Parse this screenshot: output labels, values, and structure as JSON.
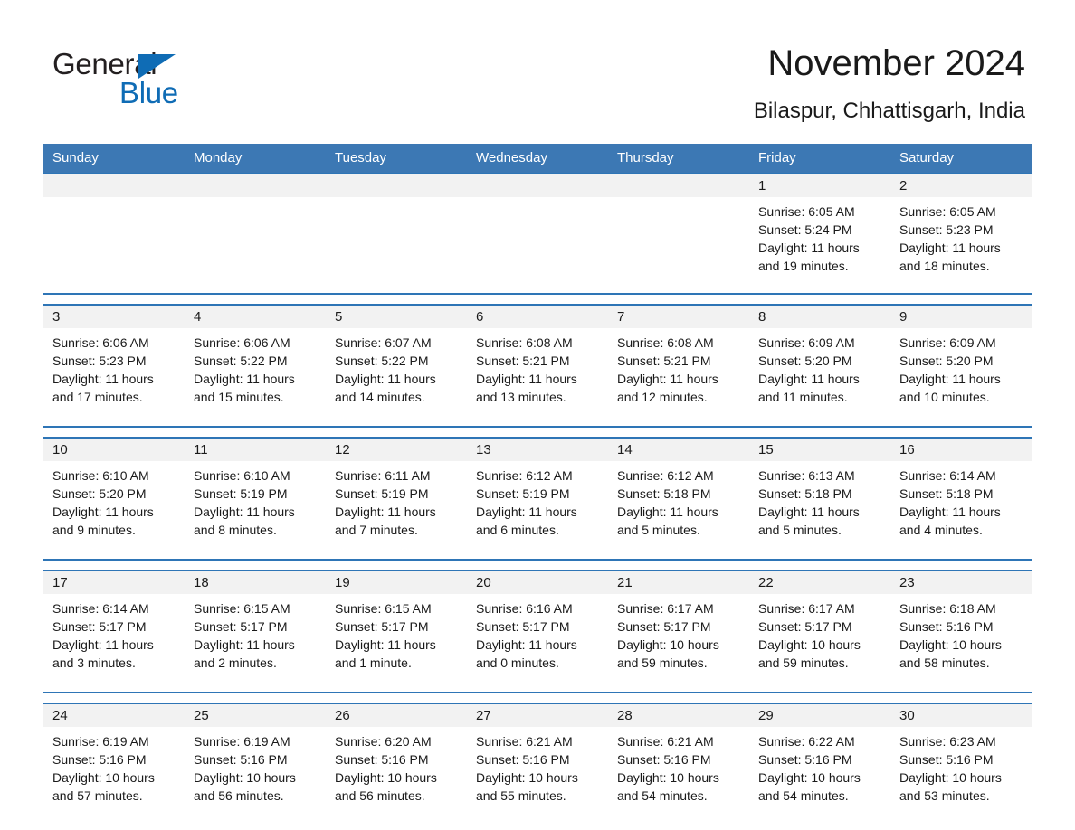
{
  "brand": {
    "name_part1": "General",
    "name_part2": "Blue",
    "triangle_color": "#0f6cb5"
  },
  "header": {
    "month_title": "November 2024",
    "location": "Bilaspur, Chhattisgarh, India"
  },
  "theme": {
    "header_blue": "#3c78b4",
    "row_border_blue": "#2e75b6",
    "daynum_band": "#f2f2f2",
    "text": "#1a1a1a"
  },
  "weekdays": [
    "Sunday",
    "Monday",
    "Tuesday",
    "Wednesday",
    "Thursday",
    "Friday",
    "Saturday"
  ],
  "weeks": [
    [
      {
        "day": "",
        "sunrise": "",
        "sunset": "",
        "daylight1": "",
        "daylight2": ""
      },
      {
        "day": "",
        "sunrise": "",
        "sunset": "",
        "daylight1": "",
        "daylight2": ""
      },
      {
        "day": "",
        "sunrise": "",
        "sunset": "",
        "daylight1": "",
        "daylight2": ""
      },
      {
        "day": "",
        "sunrise": "",
        "sunset": "",
        "daylight1": "",
        "daylight2": ""
      },
      {
        "day": "",
        "sunrise": "",
        "sunset": "",
        "daylight1": "",
        "daylight2": ""
      },
      {
        "day": "1",
        "sunrise": "Sunrise: 6:05 AM",
        "sunset": "Sunset: 5:24 PM",
        "daylight1": "Daylight: 11 hours",
        "daylight2": "and 19 minutes."
      },
      {
        "day": "2",
        "sunrise": "Sunrise: 6:05 AM",
        "sunset": "Sunset: 5:23 PM",
        "daylight1": "Daylight: 11 hours",
        "daylight2": "and 18 minutes."
      }
    ],
    [
      {
        "day": "3",
        "sunrise": "Sunrise: 6:06 AM",
        "sunset": "Sunset: 5:23 PM",
        "daylight1": "Daylight: 11 hours",
        "daylight2": "and 17 minutes."
      },
      {
        "day": "4",
        "sunrise": "Sunrise: 6:06 AM",
        "sunset": "Sunset: 5:22 PM",
        "daylight1": "Daylight: 11 hours",
        "daylight2": "and 15 minutes."
      },
      {
        "day": "5",
        "sunrise": "Sunrise: 6:07 AM",
        "sunset": "Sunset: 5:22 PM",
        "daylight1": "Daylight: 11 hours",
        "daylight2": "and 14 minutes."
      },
      {
        "day": "6",
        "sunrise": "Sunrise: 6:08 AM",
        "sunset": "Sunset: 5:21 PM",
        "daylight1": "Daylight: 11 hours",
        "daylight2": "and 13 minutes."
      },
      {
        "day": "7",
        "sunrise": "Sunrise: 6:08 AM",
        "sunset": "Sunset: 5:21 PM",
        "daylight1": "Daylight: 11 hours",
        "daylight2": "and 12 minutes."
      },
      {
        "day": "8",
        "sunrise": "Sunrise: 6:09 AM",
        "sunset": "Sunset: 5:20 PM",
        "daylight1": "Daylight: 11 hours",
        "daylight2": "and 11 minutes."
      },
      {
        "day": "9",
        "sunrise": "Sunrise: 6:09 AM",
        "sunset": "Sunset: 5:20 PM",
        "daylight1": "Daylight: 11 hours",
        "daylight2": "and 10 minutes."
      }
    ],
    [
      {
        "day": "10",
        "sunrise": "Sunrise: 6:10 AM",
        "sunset": "Sunset: 5:20 PM",
        "daylight1": "Daylight: 11 hours",
        "daylight2": "and 9 minutes."
      },
      {
        "day": "11",
        "sunrise": "Sunrise: 6:10 AM",
        "sunset": "Sunset: 5:19 PM",
        "daylight1": "Daylight: 11 hours",
        "daylight2": "and 8 minutes."
      },
      {
        "day": "12",
        "sunrise": "Sunrise: 6:11 AM",
        "sunset": "Sunset: 5:19 PM",
        "daylight1": "Daylight: 11 hours",
        "daylight2": "and 7 minutes."
      },
      {
        "day": "13",
        "sunrise": "Sunrise: 6:12 AM",
        "sunset": "Sunset: 5:19 PM",
        "daylight1": "Daylight: 11 hours",
        "daylight2": "and 6 minutes."
      },
      {
        "day": "14",
        "sunrise": "Sunrise: 6:12 AM",
        "sunset": "Sunset: 5:18 PM",
        "daylight1": "Daylight: 11 hours",
        "daylight2": "and 5 minutes."
      },
      {
        "day": "15",
        "sunrise": "Sunrise: 6:13 AM",
        "sunset": "Sunset: 5:18 PM",
        "daylight1": "Daylight: 11 hours",
        "daylight2": "and 5 minutes."
      },
      {
        "day": "16",
        "sunrise": "Sunrise: 6:14 AM",
        "sunset": "Sunset: 5:18 PM",
        "daylight1": "Daylight: 11 hours",
        "daylight2": "and 4 minutes."
      }
    ],
    [
      {
        "day": "17",
        "sunrise": "Sunrise: 6:14 AM",
        "sunset": "Sunset: 5:17 PM",
        "daylight1": "Daylight: 11 hours",
        "daylight2": "and 3 minutes."
      },
      {
        "day": "18",
        "sunrise": "Sunrise: 6:15 AM",
        "sunset": "Sunset: 5:17 PM",
        "daylight1": "Daylight: 11 hours",
        "daylight2": "and 2 minutes."
      },
      {
        "day": "19",
        "sunrise": "Sunrise: 6:15 AM",
        "sunset": "Sunset: 5:17 PM",
        "daylight1": "Daylight: 11 hours",
        "daylight2": "and 1 minute."
      },
      {
        "day": "20",
        "sunrise": "Sunrise: 6:16 AM",
        "sunset": "Sunset: 5:17 PM",
        "daylight1": "Daylight: 11 hours",
        "daylight2": "and 0 minutes."
      },
      {
        "day": "21",
        "sunrise": "Sunrise: 6:17 AM",
        "sunset": "Sunset: 5:17 PM",
        "daylight1": "Daylight: 10 hours",
        "daylight2": "and 59 minutes."
      },
      {
        "day": "22",
        "sunrise": "Sunrise: 6:17 AM",
        "sunset": "Sunset: 5:17 PM",
        "daylight1": "Daylight: 10 hours",
        "daylight2": "and 59 minutes."
      },
      {
        "day": "23",
        "sunrise": "Sunrise: 6:18 AM",
        "sunset": "Sunset: 5:16 PM",
        "daylight1": "Daylight: 10 hours",
        "daylight2": "and 58 minutes."
      }
    ],
    [
      {
        "day": "24",
        "sunrise": "Sunrise: 6:19 AM",
        "sunset": "Sunset: 5:16 PM",
        "daylight1": "Daylight: 10 hours",
        "daylight2": "and 57 minutes."
      },
      {
        "day": "25",
        "sunrise": "Sunrise: 6:19 AM",
        "sunset": "Sunset: 5:16 PM",
        "daylight1": "Daylight: 10 hours",
        "daylight2": "and 56 minutes."
      },
      {
        "day": "26",
        "sunrise": "Sunrise: 6:20 AM",
        "sunset": "Sunset: 5:16 PM",
        "daylight1": "Daylight: 10 hours",
        "daylight2": "and 56 minutes."
      },
      {
        "day": "27",
        "sunrise": "Sunrise: 6:21 AM",
        "sunset": "Sunset: 5:16 PM",
        "daylight1": "Daylight: 10 hours",
        "daylight2": "and 55 minutes."
      },
      {
        "day": "28",
        "sunrise": "Sunrise: 6:21 AM",
        "sunset": "Sunset: 5:16 PM",
        "daylight1": "Daylight: 10 hours",
        "daylight2": "and 54 minutes."
      },
      {
        "day": "29",
        "sunrise": "Sunrise: 6:22 AM",
        "sunset": "Sunset: 5:16 PM",
        "daylight1": "Daylight: 10 hours",
        "daylight2": "and 54 minutes."
      },
      {
        "day": "30",
        "sunrise": "Sunrise: 6:23 AM",
        "sunset": "Sunset: 5:16 PM",
        "daylight1": "Daylight: 10 hours",
        "daylight2": "and 53 minutes."
      }
    ]
  ]
}
